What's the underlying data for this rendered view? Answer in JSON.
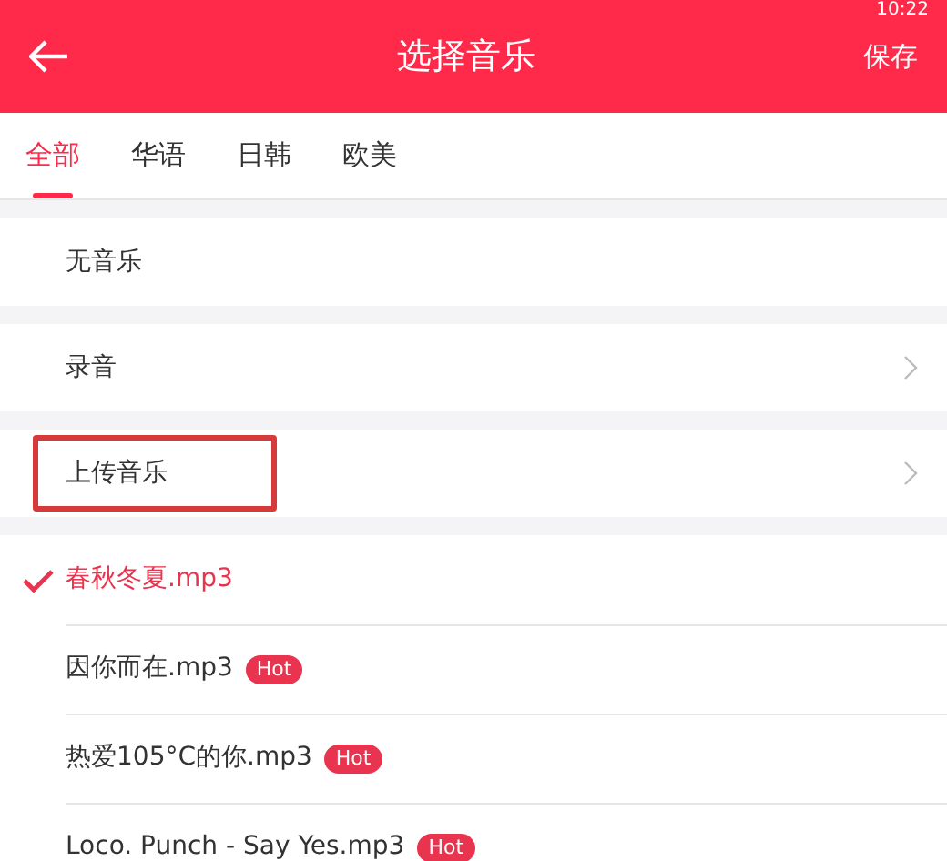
{
  "status_bar": {
    "time": "10:22"
  },
  "header": {
    "title": "选择音乐",
    "action": "保存"
  },
  "tabs": [
    {
      "label": "全部",
      "selected": true
    },
    {
      "label": "华语",
      "selected": false
    },
    {
      "label": "日韩",
      "selected": false
    },
    {
      "label": "欧美",
      "selected": false
    }
  ],
  "options": [
    {
      "label": "无音乐",
      "kind": "plain",
      "highlighted": false
    },
    {
      "label": "录音",
      "kind": "link",
      "highlighted": false
    },
    {
      "label": "上传音乐",
      "kind": "link",
      "highlighted": true
    }
  ],
  "songs": [
    {
      "title": "春秋冬夏.mp3",
      "selected": true
    },
    {
      "title": "因你而在.mp3",
      "selected": false,
      "badge": "Hot"
    },
    {
      "title": "热爱105°C的你.mp3",
      "selected": false,
      "badge": "Hot"
    },
    {
      "title": "Loco. Punch - Say Yes.mp3",
      "selected": false,
      "badge": "Hot"
    }
  ]
}
